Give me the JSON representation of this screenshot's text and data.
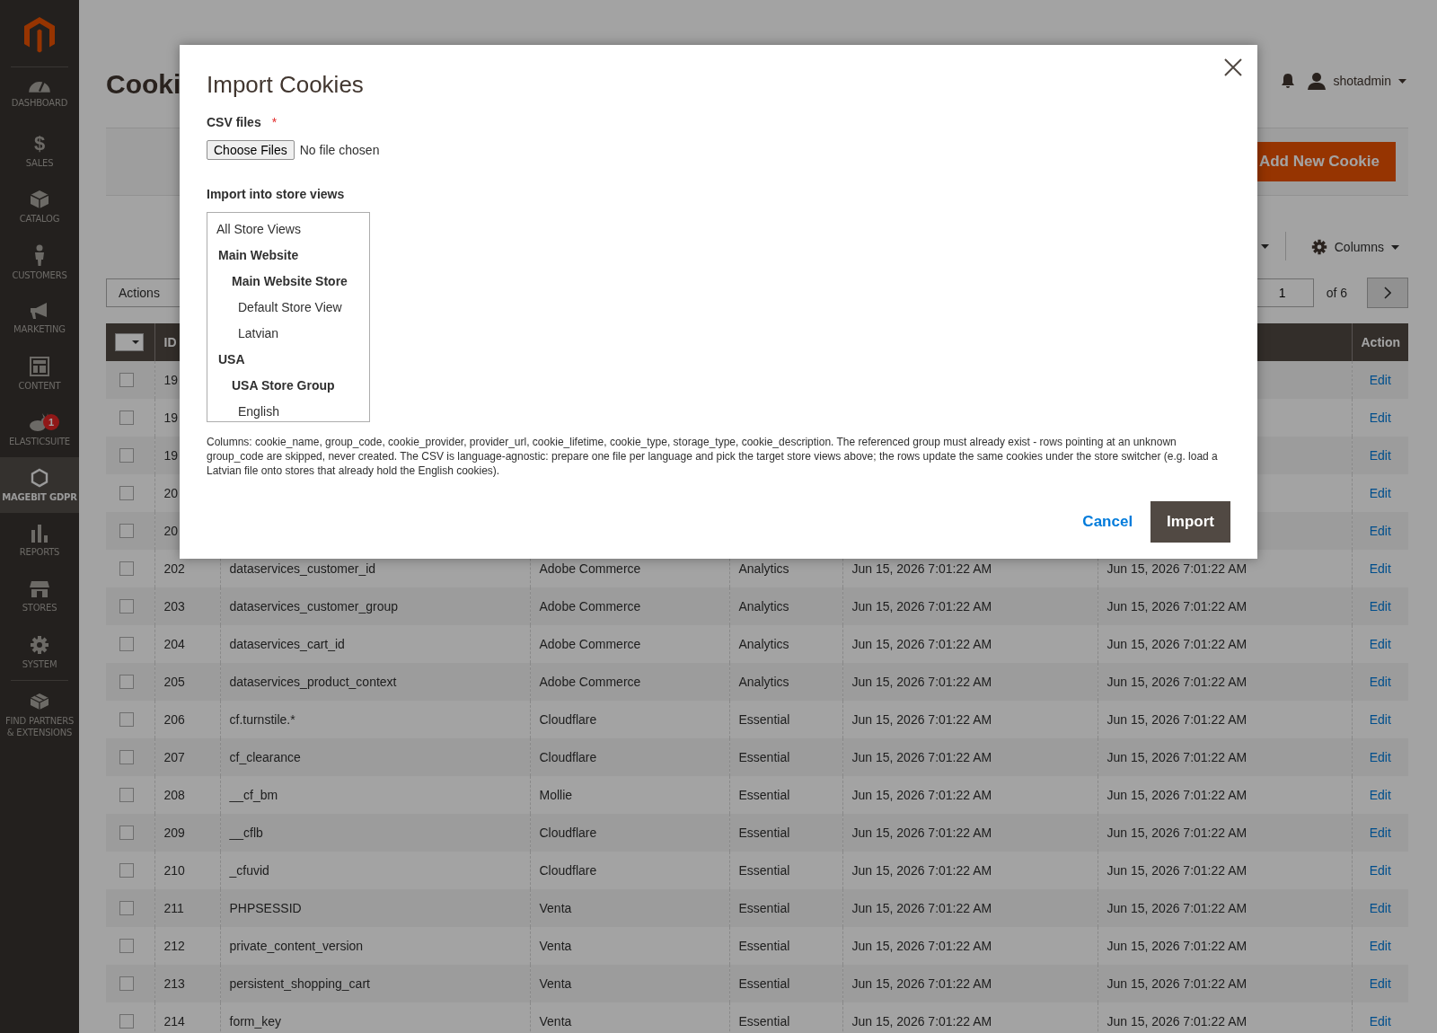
{
  "sidebar": {
    "items": [
      {
        "label": "DASHBOARD",
        "selected": false
      },
      {
        "label": "SALES",
        "glyph": "$",
        "selected": false
      },
      {
        "label": "CATALOG",
        "selected": false
      },
      {
        "label": "CUSTOMERS",
        "selected": false
      },
      {
        "label": "MARKETING",
        "selected": false
      },
      {
        "label": "CONTENT",
        "selected": false
      },
      {
        "label": "ELASTICSUITE",
        "badge": "1",
        "selected": false
      },
      {
        "label": "MAGEBIT GDPR",
        "selected": true
      },
      {
        "label": "REPORTS",
        "selected": false
      },
      {
        "label": "STORES",
        "selected": false
      },
      {
        "label": "SYSTEM",
        "selected": false
      },
      {
        "label": "FIND PARTNERS & EXTENSIONS",
        "selected": false
      }
    ]
  },
  "header": {
    "title": "Cooki",
    "user": "shotadmin"
  },
  "add_button": "Add New Cookie",
  "toolbar": {
    "columns": "Columns",
    "actions": "Actions",
    "page": "1",
    "page_total": "of 6"
  },
  "table": {
    "header": {
      "checked": false,
      "id": "ID",
      "action": "Action"
    },
    "rows": [
      {
        "id": "19",
        "checked": false,
        "action": "Edit"
      },
      {
        "id": "19",
        "checked": false,
        "action": "Edit"
      },
      {
        "id": "19",
        "checked": false,
        "action": "Edit"
      },
      {
        "id": "20",
        "checked": false,
        "action": "Edit"
      },
      {
        "id": "20",
        "checked": false,
        "action": "Edit"
      },
      {
        "id": "202",
        "checked": false,
        "name": "dataservices_customer_id",
        "provider": "Adobe Commerce",
        "category": "Analytics",
        "created": "Jun 15, 2026 7:01:22 AM",
        "updated": "Jun 15, 2026 7:01:22 AM",
        "action": "Edit"
      },
      {
        "id": "203",
        "checked": false,
        "name": "dataservices_customer_group",
        "provider": "Adobe Commerce",
        "category": "Analytics",
        "created": "Jun 15, 2026 7:01:22 AM",
        "updated": "Jun 15, 2026 7:01:22 AM",
        "action": "Edit"
      },
      {
        "id": "204",
        "checked": false,
        "name": "dataservices_cart_id",
        "provider": "Adobe Commerce",
        "category": "Analytics",
        "created": "Jun 15, 2026 7:01:22 AM",
        "updated": "Jun 15, 2026 7:01:22 AM",
        "action": "Edit"
      },
      {
        "id": "205",
        "checked": false,
        "name": "dataservices_product_context",
        "provider": "Adobe Commerce",
        "category": "Analytics",
        "created": "Jun 15, 2026 7:01:22 AM",
        "updated": "Jun 15, 2026 7:01:22 AM",
        "action": "Edit"
      },
      {
        "id": "206",
        "checked": false,
        "name": "cf.turnstile.*",
        "provider": "Cloudflare",
        "category": "Essential",
        "created": "Jun 15, 2026 7:01:22 AM",
        "updated": "Jun 15, 2026 7:01:22 AM",
        "action": "Edit"
      },
      {
        "id": "207",
        "checked": false,
        "name": "cf_clearance",
        "provider": "Cloudflare",
        "category": "Essential",
        "created": "Jun 15, 2026 7:01:22 AM",
        "updated": "Jun 15, 2026 7:01:22 AM",
        "action": "Edit"
      },
      {
        "id": "208",
        "checked": false,
        "name": "__cf_bm",
        "provider": "Mollie",
        "category": "Essential",
        "created": "Jun 15, 2026 7:01:22 AM",
        "updated": "Jun 15, 2026 7:01:22 AM",
        "action": "Edit"
      },
      {
        "id": "209",
        "checked": false,
        "name": "__cflb",
        "provider": "Cloudflare",
        "category": "Essential",
        "created": "Jun 15, 2026 7:01:22 AM",
        "updated": "Jun 15, 2026 7:01:22 AM",
        "action": "Edit"
      },
      {
        "id": "210",
        "checked": false,
        "name": "_cfuvid",
        "provider": "Cloudflare",
        "category": "Essential",
        "created": "Jun 15, 2026 7:01:22 AM",
        "updated": "Jun 15, 2026 7:01:22 AM",
        "action": "Edit"
      },
      {
        "id": "211",
        "checked": false,
        "name": "PHPSESSID",
        "provider": "Venta",
        "category": "Essential",
        "created": "Jun 15, 2026 7:01:22 AM",
        "updated": "Jun 15, 2026 7:01:22 AM",
        "action": "Edit"
      },
      {
        "id": "212",
        "checked": false,
        "name": "private_content_version",
        "provider": "Venta",
        "category": "Essential",
        "created": "Jun 15, 2026 7:01:22 AM",
        "updated": "Jun 15, 2026 7:01:22 AM",
        "action": "Edit"
      },
      {
        "id": "213",
        "checked": false,
        "name": "persistent_shopping_cart",
        "provider": "Venta",
        "category": "Essential",
        "created": "Jun 15, 2026 7:01:22 AM",
        "updated": "Jun 15, 2026 7:01:22 AM",
        "action": "Edit"
      },
      {
        "id": "214",
        "checked": false,
        "name": "form_key",
        "provider": "Venta",
        "category": "Essential",
        "created": "Jun 15, 2026 7:01:22 AM",
        "updated": "Jun 15, 2026 7:01:22 AM",
        "action": "Edit"
      }
    ]
  },
  "modal": {
    "title": "Import Cookies",
    "csv_label": "CSV files",
    "required_mark": "*",
    "choose_button": "Choose Files",
    "file_status": "No file chosen",
    "store_label": "Import into store views",
    "store_options": [
      {
        "label": "All Store Views"
      },
      {
        "label": "Main Website",
        "children": [
          {
            "label": "Main Website Store",
            "children": [
              {
                "label": "Default Store View"
              },
              {
                "label": "Latvian"
              }
            ]
          }
        ]
      },
      {
        "label": "USA",
        "children": [
          {
            "label": "USA Store Group",
            "children": [
              {
                "label": "English"
              }
            ]
          }
        ]
      }
    ],
    "note": "Columns: cookie_name, group_code, cookie_provider, provider_url, cookie_lifetime, cookie_type, storage_type, cookie_description. The referenced group must already exist - rows pointing at an unknown group_code are skipped, never created. The CSV is language-agnostic: prepare one file per language and pick the target store views above; the rows update the same cookies under the store switcher (e.g. load a Latvian file onto stores that already hold the English cookies).",
    "cancel": "Cancel",
    "import": "Import"
  }
}
